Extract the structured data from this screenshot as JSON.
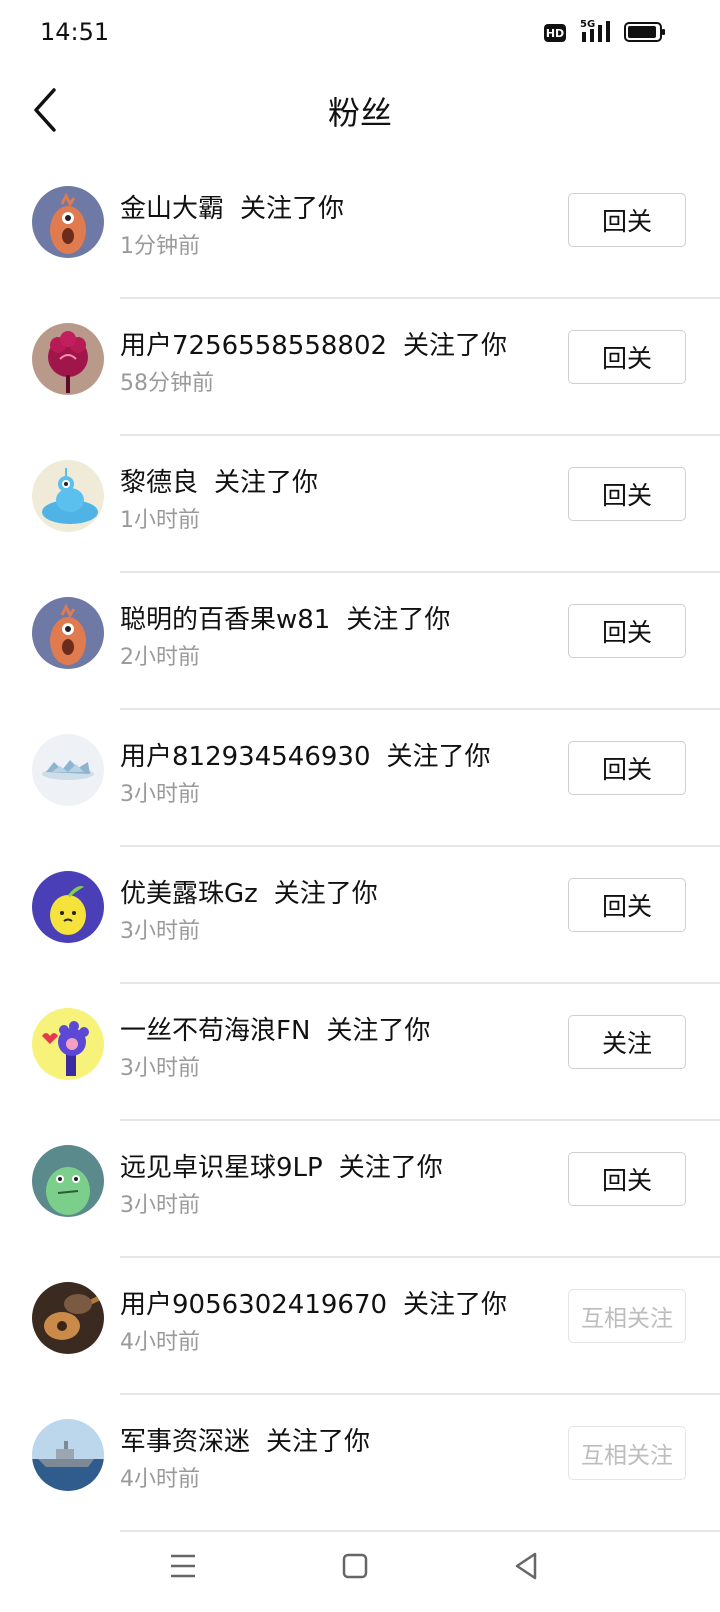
{
  "status_bar": {
    "time": "14:51",
    "hd_label": "HD",
    "network_label": "5G",
    "icons": [
      "hd-icon",
      "signal-icon",
      "battery-icon"
    ]
  },
  "header": {
    "title": "粉丝",
    "back_icon": "chevron-left-icon"
  },
  "followers": [
    {
      "name": "金山大霸",
      "action": "关注了你",
      "time": "1分钟前",
      "button": "回关",
      "state": "follow-back"
    },
    {
      "name": "用户7256558558802",
      "action": "关注了你",
      "time": "58分钟前",
      "button": "回关",
      "state": "follow-back"
    },
    {
      "name": "黎德良",
      "action": "关注了你",
      "time": "1小时前",
      "button": "回关",
      "state": "follow-back"
    },
    {
      "name": "聪明的百香果w81",
      "action": "关注了你",
      "time": "2小时前",
      "button": "回关",
      "state": "follow-back"
    },
    {
      "name": "用户812934546930",
      "action": "关注了你",
      "time": "3小时前",
      "button": "回关",
      "state": "follow-back"
    },
    {
      "name": "优美露珠Gz",
      "action": "关注了你",
      "time": "3小时前",
      "button": "回关",
      "state": "follow-back"
    },
    {
      "name": "一丝不苟海浪FN",
      "action": "关注了你",
      "time": "3小时前",
      "button": "关注",
      "state": "follow"
    },
    {
      "name": "远见卓识星球9LP",
      "action": "关注了你",
      "time": "3小时前",
      "button": "回关",
      "state": "follow-back"
    },
    {
      "name": "用户9056302419670",
      "action": "关注了你",
      "time": "4小时前",
      "button": "互相关注",
      "state": "mutual"
    },
    {
      "name": "军事资深迷",
      "action": "关注了你",
      "time": "4小时前",
      "button": "互相关注",
      "state": "mutual"
    }
  ],
  "nav_bar": {
    "icons": [
      "menu-icon",
      "home-square-icon",
      "back-triangle-icon"
    ]
  },
  "colors": {
    "background": "#ffffff",
    "text_primary": "#111111",
    "text_secondary": "#9a9a9a",
    "divider": "#e6e6e6",
    "button_border": "#cfcfcf",
    "mutual_text": "#bdbdbd"
  }
}
